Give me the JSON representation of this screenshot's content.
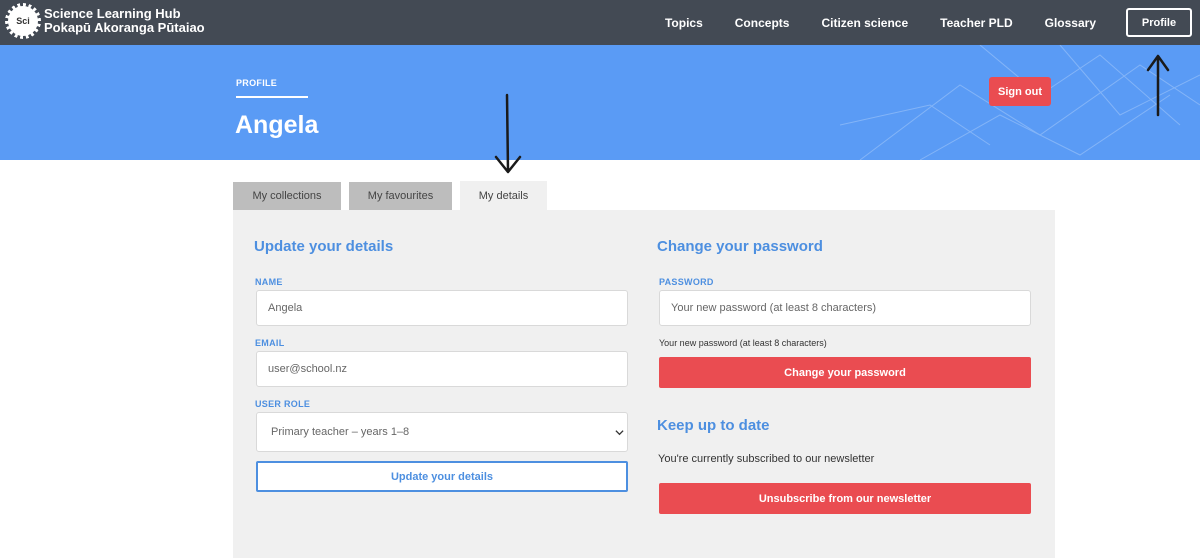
{
  "header": {
    "logo_badge": "Sci",
    "logo_line1": "Science Learning Hub",
    "logo_line2": "Pokapū Akoranga Pūtaiao",
    "nav": [
      "Topics",
      "Concepts",
      "Citizen science",
      "Teacher PLD",
      "Glossary"
    ],
    "profile_label": "Profile"
  },
  "hero": {
    "crumb": "PROFILE",
    "title": "Angela",
    "signout_label": "Sign out"
  },
  "tabs": [
    "My collections",
    "My favourites",
    "My details"
  ],
  "details": {
    "heading": "Update your details",
    "name_label": "NAME",
    "name_value": "Angela",
    "email_label": "EMAIL",
    "email_value": "user@school.nz",
    "role_label": "USER ROLE",
    "role_value": "Primary teacher – years 1–8",
    "submit_label": "Update your details"
  },
  "password": {
    "heading": "Change your password",
    "label": "PASSWORD",
    "placeholder": "Your new password (at least 8 characters)",
    "hint": "Your new password (at least 8 characters)",
    "submit_label": "Change your password"
  },
  "newsletter": {
    "heading": "Keep up to date",
    "status": "You're currently subscribed to our newsletter",
    "unsubscribe_label": "Unsubscribe from our newsletter"
  },
  "colors": {
    "nav_bg": "#434a54",
    "hero_bg": "#5a9bf5",
    "accent": "#4d8fe0",
    "danger": "#ea4c51",
    "panel_bg": "#f0f0f0"
  }
}
